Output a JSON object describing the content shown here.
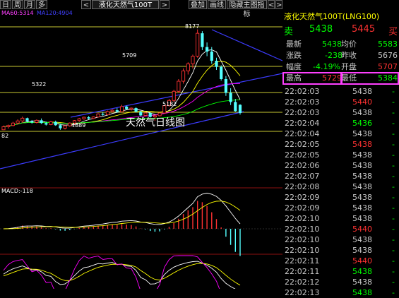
{
  "toolbar": {
    "buttons": [
      "日",
      "周",
      "月",
      "多"
    ],
    "prev": "<",
    "title": "液化天然气100T",
    "next": ">",
    "right_buttons": [
      "叠加",
      "画线",
      "隐藏主图指标",
      "<",
      ">"
    ]
  },
  "chart": {
    "ma_legend": {
      "ma60": "MA60:5314",
      "ma120": "MA120:4904"
    },
    "watermark": "天然气日线图",
    "price_labels": {
      "peak": "8177",
      "p5709": "5709",
      "p5322": "5322",
      "p5182": "5182",
      "p4889": "4889"
    },
    "left_marker": "82",
    "macd_label": "MACD:-118",
    "colors": {
      "up": "#ff3232",
      "down": "#54ffff",
      "ma_white": "#ffffff",
      "ma_yellow": "#ffff00",
      "ma_magenta": "#ff00ff",
      "ma_green": "#00ff00",
      "trendline": "#3c3cff"
    }
  },
  "quote": {
    "title": "液化天然气100T(LNG100)",
    "sell_label": "卖",
    "sell_price": "5438",
    "buy_price": "5445",
    "buy_label": "买",
    "rows": [
      {
        "l1": "最新",
        "v1": "5438",
        "l2": "均价",
        "v2": "5583"
      },
      {
        "l1": "涨跌",
        "v1": "-238",
        "l2": "昨收",
        "v2": "5676"
      },
      {
        "l1": "幅度",
        "v1": "-4.19%",
        "l2": "开盘",
        "v2": "5707"
      },
      {
        "l1": "最高",
        "v1": "5729",
        "l2": "最低",
        "v2": "5384"
      }
    ]
  },
  "ticks": [
    {
      "time": "22:02:03",
      "price": "5438",
      "c": "white",
      "vol": "-"
    },
    {
      "time": "22:02:03",
      "price": "5440",
      "c": "red",
      "vol": "-"
    },
    {
      "time": "22:02:03",
      "price": "5438",
      "c": "white",
      "vol": "-"
    },
    {
      "time": "22:02:04",
      "price": "5436",
      "c": "green",
      "vol": "-"
    },
    {
      "time": "22:02:04",
      "price": "5438",
      "c": "white",
      "vol": "-"
    },
    {
      "time": "22:02:05",
      "price": "5438",
      "c": "red",
      "vol": "-"
    },
    {
      "time": "22:02:05",
      "price": "5438",
      "c": "white",
      "vol": "-"
    },
    {
      "time": "22:02:06",
      "price": "5438",
      "c": "white",
      "vol": "-"
    },
    {
      "time": "22:02:07",
      "price": "5438",
      "c": "white",
      "vol": "-"
    },
    {
      "time": "22:02:08",
      "price": "5438",
      "c": "white",
      "vol": "-"
    },
    {
      "time": "22:02:09",
      "price": "5438",
      "c": "white",
      "vol": "-"
    },
    {
      "time": "22:02:09",
      "price": "5438",
      "c": "white",
      "vol": "-"
    },
    {
      "time": "22:02:10",
      "price": "5438",
      "c": "white",
      "vol": "-"
    },
    {
      "time": "22:02:10",
      "price": "5440",
      "c": "red",
      "vol": "-"
    },
    {
      "time": "22:02:10",
      "price": "5438",
      "c": "white",
      "vol": "-"
    },
    {
      "time": "22:02:10",
      "price": "5438",
      "c": "white",
      "vol": "-"
    },
    {
      "time": "22:02:11",
      "price": "5440",
      "c": "red",
      "vol": "-"
    },
    {
      "time": "22:02:11",
      "price": "5438",
      "c": "green",
      "vol": "-"
    },
    {
      "time": "22:02:12",
      "price": "5438",
      "c": "white",
      "vol": "-"
    },
    {
      "time": "22:02:13",
      "price": "5438",
      "c": "green",
      "vol": "-"
    }
  ],
  "candles": [
    {
      "o": 4890,
      "h": 5030,
      "l": 4880,
      "c": 4990
    },
    {
      "o": 4990,
      "h": 5060,
      "l": 4930,
      "c": 5030
    },
    {
      "o": 5030,
      "h": 5150,
      "l": 5000,
      "c": 5110
    },
    {
      "o": 5110,
      "h": 5230,
      "l": 5070,
      "c": 5180
    },
    {
      "o": 5180,
      "h": 5322,
      "l": 5120,
      "c": 5270
    },
    {
      "o": 5270,
      "h": 5290,
      "l": 5130,
      "c": 5170
    },
    {
      "o": 5170,
      "h": 5210,
      "l": 5090,
      "c": 5130
    },
    {
      "o": 5130,
      "h": 5230,
      "l": 5100,
      "c": 5200
    },
    {
      "o": 5200,
      "h": 5260,
      "l": 5080,
      "c": 5110
    },
    {
      "o": 5110,
      "h": 5160,
      "l": 5030,
      "c": 5060
    },
    {
      "o": 5060,
      "h": 5180,
      "l": 5040,
      "c": 5150
    },
    {
      "o": 5150,
      "h": 5190,
      "l": 5020,
      "c": 5040
    },
    {
      "o": 5040,
      "h": 5080,
      "l": 4889,
      "c": 4940
    },
    {
      "o": 4940,
      "h": 5050,
      "l": 4900,
      "c": 5020
    },
    {
      "o": 5020,
      "h": 5130,
      "l": 4990,
      "c": 5110
    },
    {
      "o": 5110,
      "h": 5210,
      "l": 5070,
      "c": 5190
    },
    {
      "o": 5190,
      "h": 5280,
      "l": 5150,
      "c": 5250
    },
    {
      "o": 5250,
      "h": 5320,
      "l": 5220,
      "c": 5300
    },
    {
      "o": 5300,
      "h": 5340,
      "l": 5230,
      "c": 5260
    },
    {
      "o": 5260,
      "h": 5330,
      "l": 5240,
      "c": 5310
    },
    {
      "o": 5310,
      "h": 5430,
      "l": 5290,
      "c": 5410
    },
    {
      "o": 5410,
      "h": 5470,
      "l": 5350,
      "c": 5380
    },
    {
      "o": 5380,
      "h": 5520,
      "l": 5370,
      "c": 5490
    },
    {
      "o": 5490,
      "h": 5560,
      "l": 5450,
      "c": 5530
    },
    {
      "o": 5530,
      "h": 5600,
      "l": 5450,
      "c": 5480
    },
    {
      "o": 5480,
      "h": 5709,
      "l": 5470,
      "c": 5650
    },
    {
      "o": 5650,
      "h": 5680,
      "l": 5550,
      "c": 5570
    },
    {
      "o": 5570,
      "h": 5620,
      "l": 5520,
      "c": 5600
    },
    {
      "o": 5600,
      "h": 5630,
      "l": 5460,
      "c": 5480
    },
    {
      "o": 5480,
      "h": 5510,
      "l": 5330,
      "c": 5360
    },
    {
      "o": 5360,
      "h": 5470,
      "l": 5340,
      "c": 5440
    },
    {
      "o": 5440,
      "h": 5460,
      "l": 5290,
      "c": 5310
    },
    {
      "o": 5310,
      "h": 5380,
      "l": 5182,
      "c": 5350
    },
    {
      "o": 5350,
      "h": 5460,
      "l": 5330,
      "c": 5440
    },
    {
      "o": 5440,
      "h": 5700,
      "l": 5420,
      "c": 5680
    },
    {
      "o": 5680,
      "h": 5900,
      "l": 5650,
      "c": 5850
    },
    {
      "o": 5850,
      "h": 6200,
      "l": 5800,
      "c": 6150
    },
    {
      "o": 6150,
      "h": 6550,
      "l": 6100,
      "c": 6480
    },
    {
      "o": 6480,
      "h": 6900,
      "l": 6400,
      "c": 6820
    },
    {
      "o": 6820,
      "h": 7100,
      "l": 6700,
      "c": 7050
    },
    {
      "o": 7050,
      "h": 7350,
      "l": 6900,
      "c": 7300
    },
    {
      "o": 7300,
      "h": 8177,
      "l": 7250,
      "c": 8050
    },
    {
      "o": 8050,
      "h": 8120,
      "l": 7500,
      "c": 7600
    },
    {
      "o": 7600,
      "h": 7750,
      "l": 7300,
      "c": 7450
    },
    {
      "o": 7450,
      "h": 7600,
      "l": 7050,
      "c": 7150
    },
    {
      "o": 7150,
      "h": 7250,
      "l": 6850,
      "c": 6950
    },
    {
      "o": 6950,
      "h": 7000,
      "l": 6500,
      "c": 6550
    },
    {
      "o": 6550,
      "h": 6650,
      "l": 6000,
      "c": 6100
    },
    {
      "o": 6100,
      "h": 6250,
      "l": 5700,
      "c": 5800
    },
    {
      "o": 5800,
      "h": 5900,
      "l": 5480,
      "c": 5500
    },
    {
      "o": 5707,
      "h": 5729,
      "l": 5384,
      "c": 5438
    }
  ]
}
